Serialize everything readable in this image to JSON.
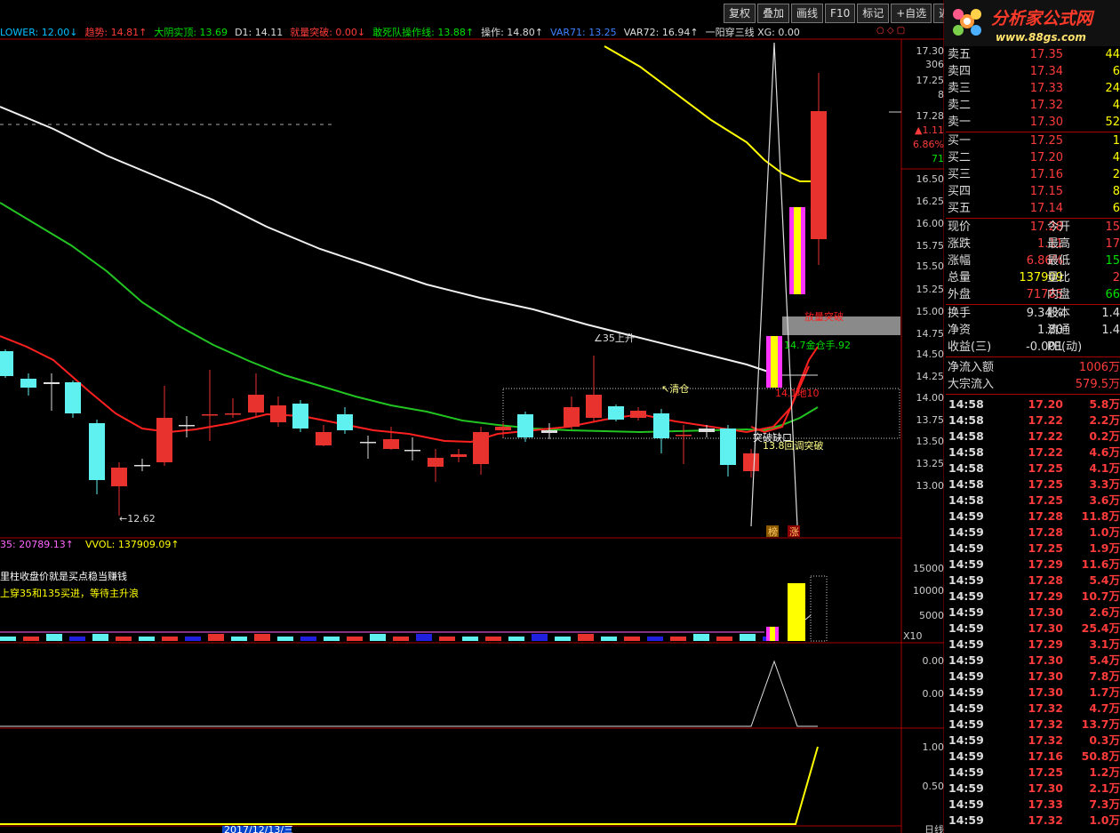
{
  "toolbar": {
    "buttons": [
      "复权",
      "叠加",
      "画线",
      "F10",
      "标记",
      "+自选",
      "返回"
    ]
  },
  "logo": {
    "text": "分析家公式网",
    "url": "www.88gs.com"
  },
  "indicators": [
    {
      "text": "LOWER: 12.00↓",
      "color": "#00bfff"
    },
    {
      "text": "趋势: 14.81↑",
      "color": "#ff3b3b"
    },
    {
      "text": "大阴实顶: 13.69",
      "color": "#00e000"
    },
    {
      "text": "D1: 14.11",
      "color": "#dddddd"
    },
    {
      "text": "就量突破: 0.00↓",
      "color": "#ff3b3b"
    },
    {
      "text": "敢死队操作线: 13.88↑",
      "color": "#00e000"
    },
    {
      "text": "操作: 14.80↑",
      "color": "#dddddd"
    },
    {
      "text": "VAR71: 13.25",
      "color": "#4080ff"
    },
    {
      "text": "VAR72: 16.94↑",
      "color": "#dddddd"
    },
    {
      "text": "一阳穿三线 XG: 0.00",
      "color": "#dddddd"
    }
  ],
  "price_axis": [
    "17.30",
    "17.25",
    "17.28",
    "16.50",
    "16.25",
    "16.00",
    "15.75",
    "15.50",
    "15.25",
    "15.00",
    "14.75",
    "14.50",
    "14.25",
    "14.00",
    "13.75",
    "13.50",
    "13.25",
    "13.00"
  ],
  "price_axis_extra": {
    "v306": "306",
    "v8": "8",
    "chg": "▲1.11",
    "pct": "6.86%",
    "v71": "71"
  },
  "annotations": {
    "low": "←12.62",
    "rise": "∠35上升",
    "clear": "↖清仓",
    "breakout_vol": "放量突破",
    "val1492": "14.7金仓手.92",
    "val1410": "14.1地10",
    "break": "突破缺口",
    "callback": "13.8回调突破",
    "bang": "榜",
    "zhang": "涨"
  },
  "vol_header": {
    "ma135": "35: 20789.13↑",
    "vwol": "VVOL: 137909.09↑"
  },
  "vol_axis": [
    "15000",
    "10000",
    "5000",
    "X10"
  ],
  "notes": [
    "里柱收盘价就是买点稳当赚钱",
    "上穿35和135买进，等待主升浪"
  ],
  "osc1_axis": [
    "0.00",
    "0.00"
  ],
  "osc2_axis": [
    "1.00",
    "0.50"
  ],
  "bottom": {
    "date": "2017/12/13/三",
    "tab": "日线"
  },
  "orderbook": {
    "sell": [
      {
        "k": "卖五",
        "p": "17.35",
        "q": "44"
      },
      {
        "k": "卖四",
        "p": "17.34",
        "q": "6"
      },
      {
        "k": "卖三",
        "p": "17.33",
        "q": "24"
      },
      {
        "k": "卖二",
        "p": "17.32",
        "q": "4"
      },
      {
        "k": "卖一",
        "p": "17.30",
        "q": "52"
      }
    ],
    "buy": [
      {
        "k": "买一",
        "p": "17.25",
        "q": "1"
      },
      {
        "k": "买二",
        "p": "17.20",
        "q": "4"
      },
      {
        "k": "买三",
        "p": "17.16",
        "q": "2"
      },
      {
        "k": "买四",
        "p": "17.15",
        "q": "8"
      },
      {
        "k": "买五",
        "p": "17.14",
        "q": "6"
      }
    ]
  },
  "quote": [
    {
      "k": "现价",
      "v": "17.28",
      "k2": "今开",
      "v2": "15"
    },
    {
      "k": "涨跌",
      "v": "1.11",
      "k2": "最高",
      "v2": "17"
    },
    {
      "k": "涨幅",
      "v": "6.86%",
      "k2": "最低",
      "v2": "15"
    },
    {
      "k": "总量",
      "v": "137909",
      "k2": "量比",
      "v2": "2"
    },
    {
      "k": "外盘",
      "v": "71785",
      "k2": "内盘",
      "v2": "66"
    }
  ],
  "quote2": [
    {
      "k": "换手",
      "v": "9.34%",
      "k2": "股本",
      "v2": "1.4"
    },
    {
      "k": "净资",
      "v": "1.80",
      "k2": "流通",
      "v2": "1.4"
    },
    {
      "k": "收益(三)",
      "v": "-0.001",
      "k2": "PE(动)",
      "v2": ""
    }
  ],
  "flow": [
    {
      "k": "净流入额",
      "v": "1006万"
    },
    {
      "k": "大宗流入",
      "v": "579.5万"
    }
  ],
  "ticks": [
    {
      "t": "14:58",
      "p": "17.20",
      "q": "5.8万",
      "c": "#ff3b3b"
    },
    {
      "t": "14:58",
      "p": "17.22",
      "q": "2.2万",
      "c": "#ff3b3b"
    },
    {
      "t": "14:58",
      "p": "17.22",
      "q": "0.2万",
      "c": "#ff3b3b"
    },
    {
      "t": "14:58",
      "p": "17.22",
      "q": "4.6万",
      "c": "#ff3b3b"
    },
    {
      "t": "14:58",
      "p": "17.25",
      "q": "4.1万",
      "c": "#ff3b3b"
    },
    {
      "t": "14:58",
      "p": "17.25",
      "q": "3.3万",
      "c": "#ff3b3b"
    },
    {
      "t": "14:58",
      "p": "17.25",
      "q": "3.6万",
      "c": "#ff3b3b"
    },
    {
      "t": "14:59",
      "p": "17.28",
      "q": "11.8万",
      "c": "#ff3b3b"
    },
    {
      "t": "14:59",
      "p": "17.28",
      "q": "1.0万",
      "c": "#ff3b3b"
    },
    {
      "t": "14:59",
      "p": "17.25",
      "q": "1.9万",
      "c": "#ff3b3b"
    },
    {
      "t": "14:59",
      "p": "17.29",
      "q": "11.6万",
      "c": "#ff3b3b"
    },
    {
      "t": "14:59",
      "p": "17.28",
      "q": "5.4万",
      "c": "#ff3b3b"
    },
    {
      "t": "14:59",
      "p": "17.29",
      "q": "10.7万",
      "c": "#ff3b3b"
    },
    {
      "t": "14:59",
      "p": "17.30",
      "q": "2.6万",
      "c": "#ff3b3b"
    },
    {
      "t": "14:59",
      "p": "17.30",
      "q": "25.4万",
      "c": "#ff3b3b"
    },
    {
      "t": "14:59",
      "p": "17.29",
      "q": "3.1万",
      "c": "#ff3b3b"
    },
    {
      "t": "14:59",
      "p": "17.30",
      "q": "5.4万",
      "c": "#ff3b3b"
    },
    {
      "t": "14:59",
      "p": "17.30",
      "q": "7.8万",
      "c": "#ff3b3b"
    },
    {
      "t": "14:59",
      "p": "17.30",
      "q": "1.7万",
      "c": "#ff3b3b"
    },
    {
      "t": "14:59",
      "p": "17.32",
      "q": "4.7万",
      "c": "#ff3b3b"
    },
    {
      "t": "14:59",
      "p": "17.32",
      "q": "13.7万",
      "c": "#ff3b3b"
    },
    {
      "t": "14:59",
      "p": "17.32",
      "q": "0.3万",
      "c": "#ff3b3b"
    },
    {
      "t": "14:59",
      "p": "17.16",
      "q": "50.8万",
      "c": "#ff3b3b"
    },
    {
      "t": "14:59",
      "p": "17.25",
      "q": "1.2万",
      "c": "#ff3b3b"
    },
    {
      "t": "14:59",
      "p": "17.30",
      "q": "2.1万",
      "c": "#ff3b3b"
    },
    {
      "t": "14:59",
      "p": "17.33",
      "q": "7.3万",
      "c": "#ff3b3b"
    },
    {
      "t": "14:59",
      "p": "17.32",
      "q": "1.0万",
      "c": "#ff3b3b"
    }
  ]
}
